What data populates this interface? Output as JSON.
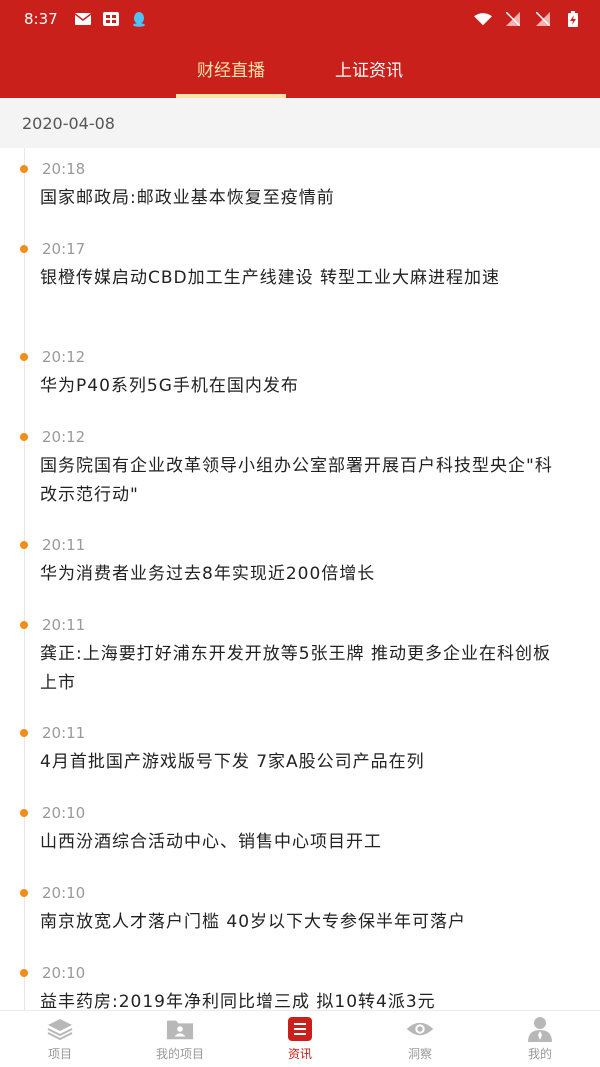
{
  "status_bar": {
    "time": "8:37"
  },
  "header": {
    "tabs": [
      {
        "label": "财经直播",
        "active": true
      },
      {
        "label": "上证资讯",
        "active": false
      }
    ]
  },
  "date": "2020-04-08",
  "news": [
    {
      "time": "20:18",
      "title": "国家邮政局:邮政业基本恢复至疫情前"
    },
    {
      "time": "20:17",
      "title": "银橙传媒启动CBD加工生产线建设 转型工业大麻进程加速"
    },
    {
      "time": "20:12",
      "title": "华为P40系列5G手机在国内发布"
    },
    {
      "time": "20:12",
      "title": "国务院国有企业改革领导小组办公室部署开展百户科技型央企\"科改示范行动\""
    },
    {
      "time": "20:11",
      "title": "华为消费者业务过去8年实现近200倍增长"
    },
    {
      "time": "20:11",
      "title": "龚正:上海要打好浦东开发开放等5张王牌 推动更多企业在科创板上市"
    },
    {
      "time": "20:11",
      "title": "4月首批国产游戏版号下发 7家A股公司产品在列"
    },
    {
      "time": "20:10",
      "title": "山西汾酒综合活动中心、销售中心项目开工"
    },
    {
      "time": "20:10",
      "title": "南京放宽人才落户门槛 40岁以下大专参保半年可落户"
    },
    {
      "time": "20:10",
      "title": "益丰药房:2019年净利同比增三成 拟10转4派3元"
    }
  ],
  "bottom_nav": [
    {
      "label": "项目",
      "icon": "layers-icon",
      "active": false
    },
    {
      "label": "我的项目",
      "icon": "folder-user-icon",
      "active": false
    },
    {
      "label": "资讯",
      "icon": "news-list-icon",
      "active": true
    },
    {
      "label": "洞察",
      "icon": "eye-icon",
      "active": false
    },
    {
      "label": "我的",
      "icon": "person-icon",
      "active": false
    }
  ],
  "colors": {
    "brand": "#c9201b",
    "tab_active": "#fbe3a8",
    "timeline_dot": "#f28c1b"
  }
}
